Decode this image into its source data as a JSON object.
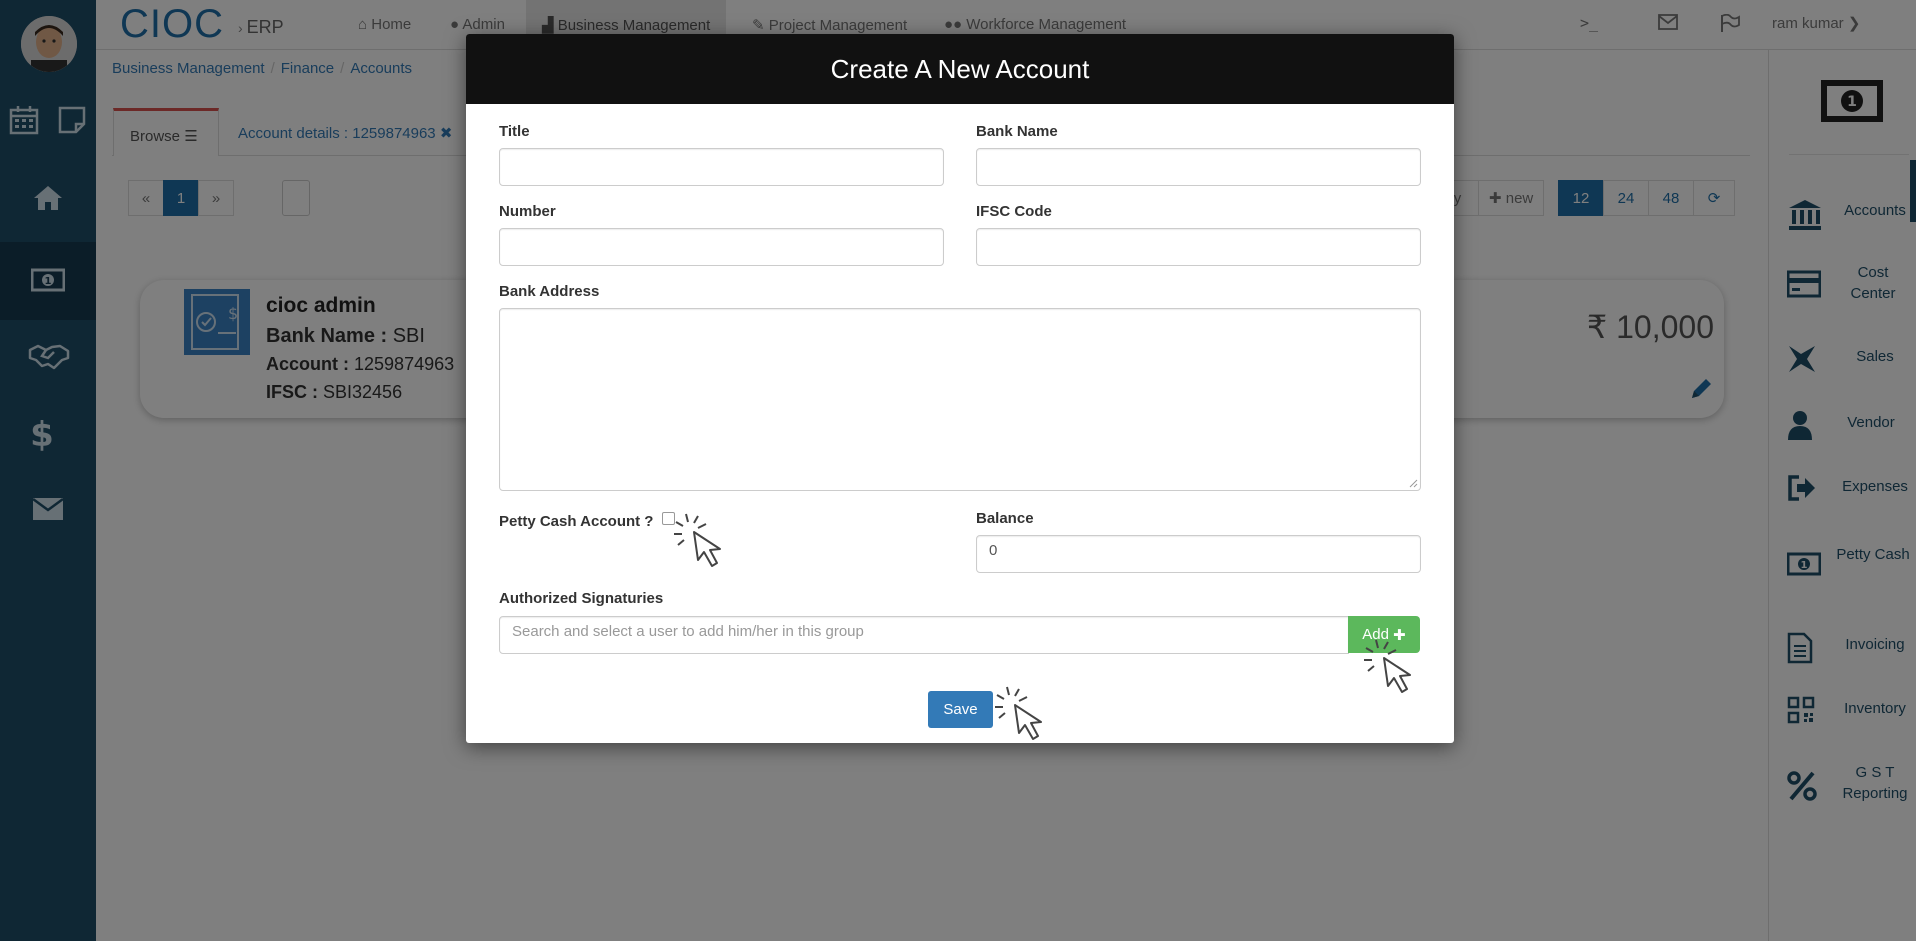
{
  "app": {
    "brand": "CIOC",
    "brand_sub": "ERP"
  },
  "navbar": {
    "items": [
      {
        "label": "Home",
        "icon": "home-icon"
      },
      {
        "label": "Admin",
        "icon": "user-icon"
      },
      {
        "label": "Business Management",
        "icon": "chart-icon"
      },
      {
        "label": "Project Management",
        "icon": "wrench-icon"
      },
      {
        "label": "Workforce Management",
        "icon": "users-icon"
      }
    ],
    "terminal": ">_",
    "user": "ram kumar"
  },
  "breadcrumb": [
    "Business Management",
    "Finance",
    "Accounts"
  ],
  "tabs": {
    "browse": "Browse",
    "details": "Account details : 1259874963"
  },
  "pagination": {
    "prev": "«",
    "current": "1",
    "next": "»",
    "right": [
      "ry",
      "new",
      "12",
      "24",
      "48"
    ]
  },
  "card": {
    "title": "cioc admin",
    "bank_label": "Bank Name :",
    "bank_value": "SBI",
    "account_label": "Account :",
    "account_value": "1259874963",
    "ifsc_label": "IFSC :",
    "ifsc_value": "SBI32456",
    "balance": "₹ 10,000"
  },
  "right_sidebar": {
    "items": [
      {
        "label": "Accounts",
        "icon": "bank-icon"
      },
      {
        "label": "Cost Center",
        "icon": "credit-card-icon"
      },
      {
        "label": "Sales",
        "icon": "sales-icon"
      },
      {
        "label": "Vendor",
        "icon": "person-icon"
      },
      {
        "label": "Expenses",
        "icon": "sign-out-icon"
      },
      {
        "label": "Petty Cash",
        "icon": "money-icon"
      },
      {
        "label": "Invoicing",
        "icon": "file-icon"
      },
      {
        "label": "Inventory",
        "icon": "qrcode-icon"
      },
      {
        "label": "G S T Reporting",
        "icon": "percent-icon"
      }
    ]
  },
  "modal": {
    "title": "Create A New Account",
    "fields": {
      "title_label": "Title",
      "bank_name_label": "Bank Name",
      "number_label": "Number",
      "ifsc_label": "IFSC Code",
      "bank_address_label": "Bank Address",
      "petty_cash_label": "Petty Cash Account ?",
      "balance_label": "Balance",
      "balance_value": "0",
      "signatories_label": "Authorized Signaturies",
      "signatories_placeholder": "Search and select a user to add him/her in this group"
    },
    "add_button": "Add",
    "save_button": "Save"
  }
}
